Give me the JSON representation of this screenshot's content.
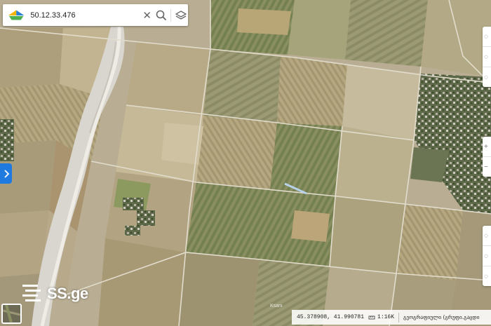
{
  "search": {
    "value": "50.12.33.476"
  },
  "map": {
    "brand": "SS.ge",
    "place_label": "Ksani"
  },
  "status": {
    "coordinates": "45.378908, 41.990781",
    "scale": "1:16K",
    "credit": "გეოგრაფიული (გრუფი.გაცდი"
  },
  "icons": {
    "logo": "ss-logo-icon",
    "clear": "close-icon",
    "search": "search-icon",
    "layers": "layers-icon",
    "expand": "chevron-right-icon",
    "watermark": "ss-logo-icon",
    "scale": "ruler-icon"
  },
  "colors": {
    "accent": "#1f7ae0",
    "terrain": "#b9ae93",
    "riverbed": "#d9d6cf",
    "field_green": "#7f8c5c"
  }
}
